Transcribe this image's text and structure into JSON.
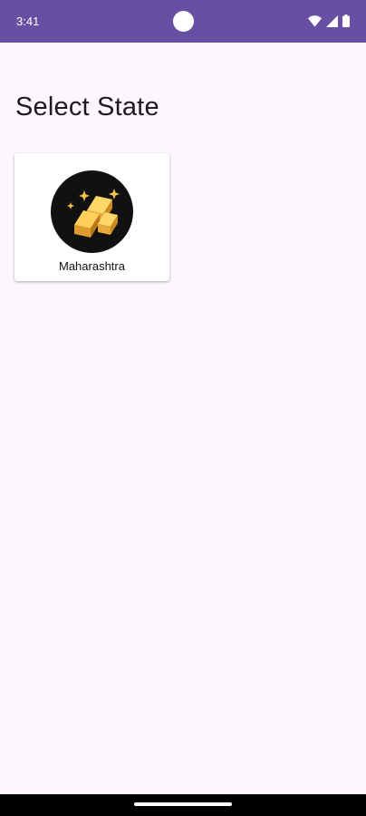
{
  "status_bar": {
    "time": "3:41",
    "background_color": "#6750a4",
    "icons": [
      "wifi-icon",
      "cellular-signal-icon",
      "battery-icon"
    ]
  },
  "page": {
    "title": "Select State"
  },
  "states": [
    {
      "name": "Maharashtra",
      "icon": "gold-bars-sparkle-icon"
    }
  ],
  "colors": {
    "background": "#fdf6fd",
    "card": "#ffffff",
    "logo_background": "#111111",
    "logo_gold": "#f4c04a"
  }
}
